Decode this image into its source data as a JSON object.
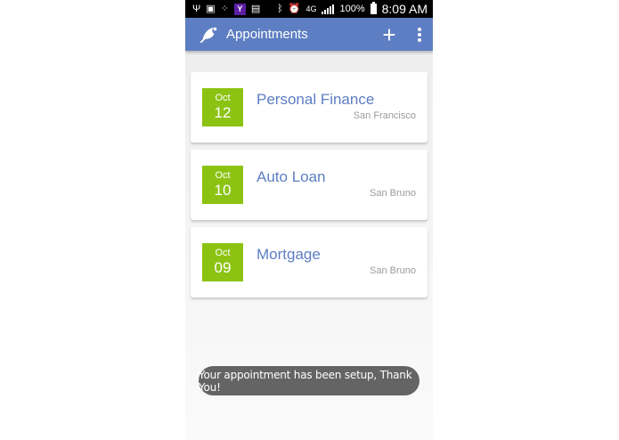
{
  "status_bar": {
    "icons": [
      "usb-icon",
      "image-icon",
      "dots-icon",
      "yahoo-icon",
      "sim-icon",
      "bluetooth-icon",
      "alarm-icon",
      "4g-icon",
      "signal-icon",
      "battery-icon"
    ],
    "yahoo_letter": "Y",
    "network": "4G",
    "battery": "100%",
    "time": "8:09 AM"
  },
  "app_bar": {
    "title": "Appointments",
    "add_label": "+"
  },
  "appointments": [
    {
      "month": "Oct",
      "day": "12",
      "title": "Personal Finance",
      "location": "San Francisco"
    },
    {
      "month": "Oct",
      "day": "10",
      "title": "Auto Loan",
      "location": "San Bruno"
    },
    {
      "month": "Oct",
      "day": "09",
      "title": "Mortgage",
      "location": "San Bruno"
    }
  ],
  "toast": {
    "message": "Your appointment has been setup, Thank You!"
  },
  "colors": {
    "app_bar": "#5d7ec2",
    "date_box": "#8cc313",
    "title_text": "#5d7ec2",
    "location_text": "#9a9a9a",
    "toast_bg": "#646464"
  }
}
